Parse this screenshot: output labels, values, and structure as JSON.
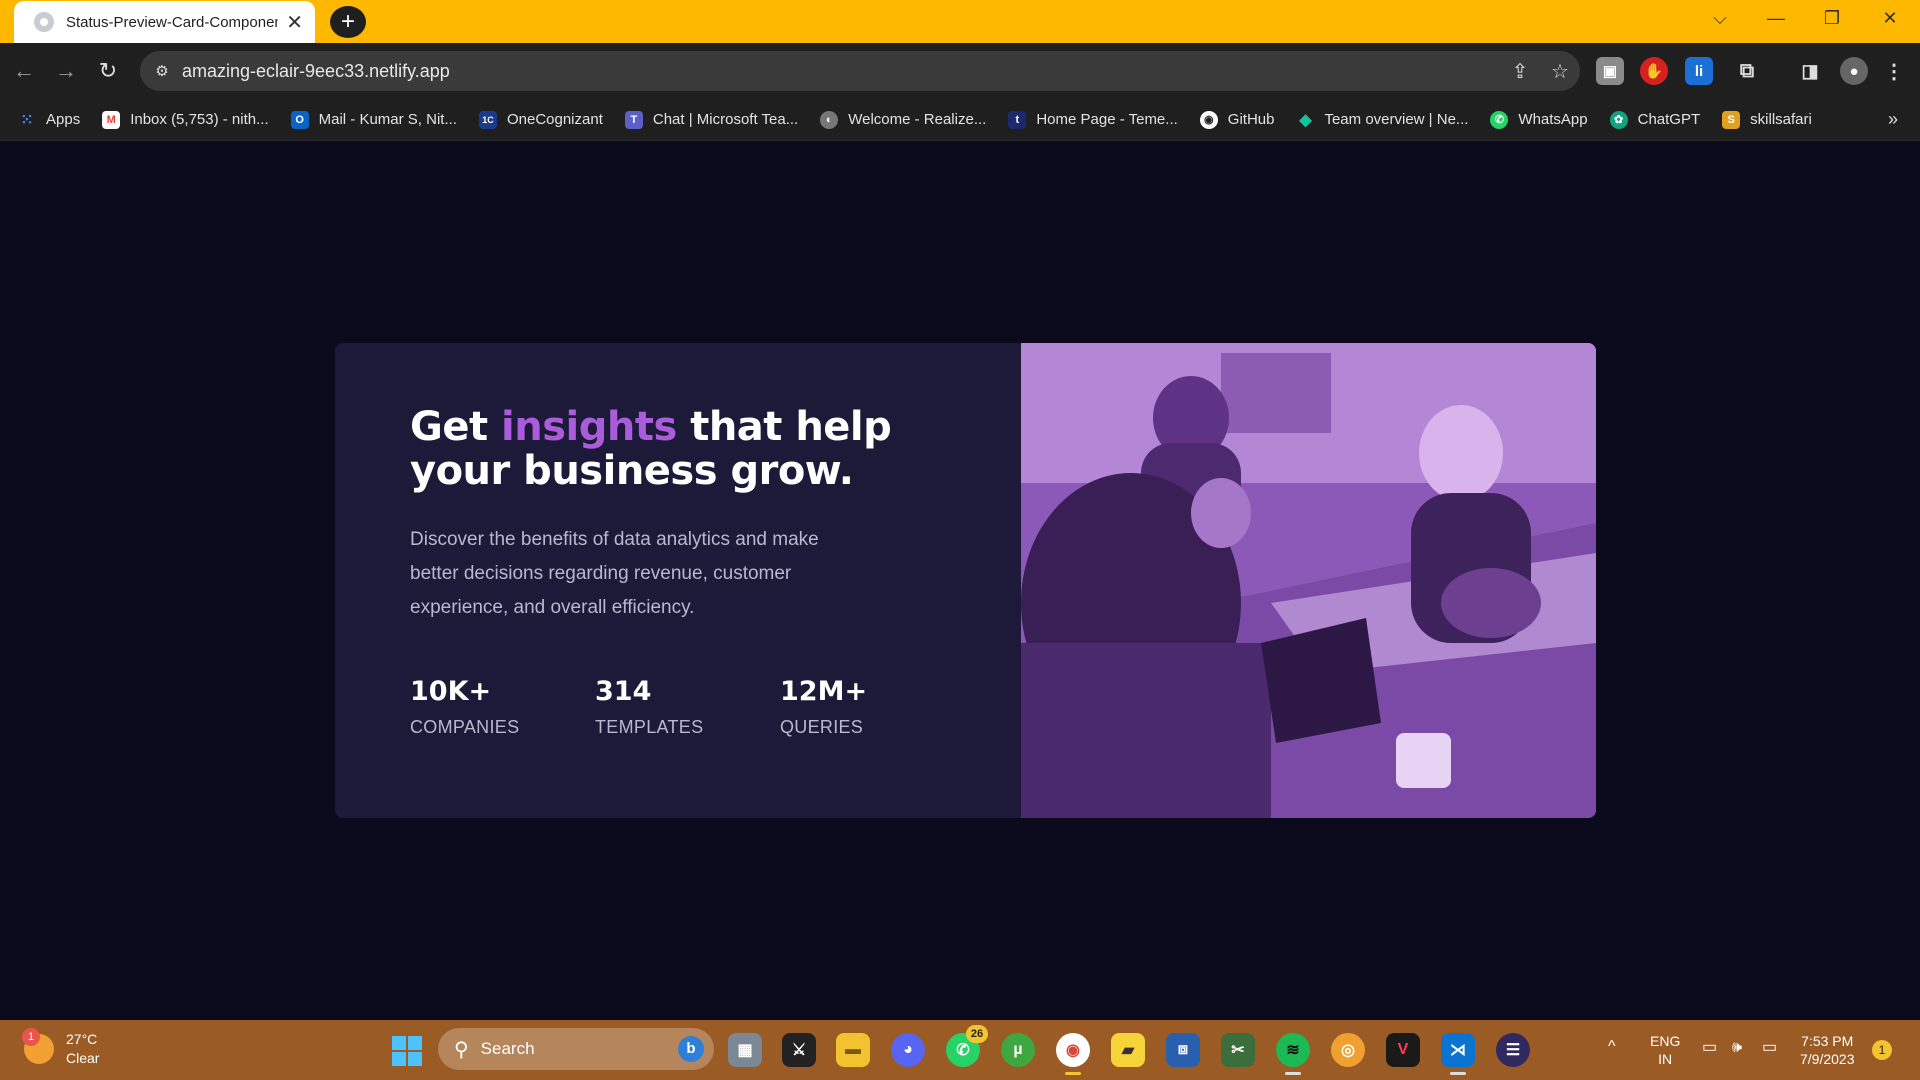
{
  "browser": {
    "tab_title": "Status-Preview-Card-Component",
    "tab_close": "✕",
    "new_tab": "+",
    "window_controls": [
      "⌵",
      "—",
      "❐",
      "✕"
    ],
    "nav": {
      "back": "←",
      "forward": "→",
      "reload": "↻"
    },
    "url": "amazing-eclair-9eec33.netlify.app",
    "site_info_icon": "tune-icon",
    "share_icon": "⇪",
    "star_icon": "☆",
    "menu_icon": "⋮"
  },
  "bookmarks": [
    {
      "label": "Apps",
      "icon": "apps-grid-icon",
      "color": "#4285f4",
      "glyph": "⁝"
    },
    {
      "label": "Inbox (5,753) - nith...",
      "icon": "gmail-icon",
      "color": "#ea4335",
      "glyph": "M"
    },
    {
      "label": "Mail - Kumar S, Nit...",
      "icon": "outlook-icon",
      "color": "#0a64c8",
      "glyph": "O"
    },
    {
      "label": "OneCognizant",
      "icon": "onecognizant-icon",
      "color": "#1a3a8a",
      "glyph": "1C"
    },
    {
      "label": "Chat | Microsoft Tea...",
      "icon": "teams-icon",
      "color": "#5b5fc7",
      "glyph": "T"
    },
    {
      "label": "Welcome - Realize...",
      "icon": "globe-icon",
      "color": "#777777",
      "glyph": "◐"
    },
    {
      "label": "Home Page - Teme...",
      "icon": "temenos-icon",
      "color": "#1b2a6b",
      "glyph": "t"
    },
    {
      "label": "GitHub",
      "icon": "github-icon",
      "color": "#333333",
      "glyph": "◉"
    },
    {
      "label": "Team overview | Ne...",
      "icon": "diamond-icon",
      "color": "#10a37f",
      "glyph": "◆"
    },
    {
      "label": "WhatsApp",
      "icon": "whatsapp-icon",
      "color": "#25d366",
      "glyph": "✆"
    },
    {
      "label": "ChatGPT",
      "icon": "chatgpt-icon",
      "color": "#10a37f",
      "glyph": "✿"
    },
    {
      "label": "skillsafari",
      "icon": "skillsafari-icon",
      "color": "#e0a020",
      "glyph": "S"
    }
  ],
  "bookmarks_more": "»",
  "card": {
    "headline_before": "Get ",
    "headline_accent": "insights",
    "headline_after": " that help your business grow.",
    "description": "Discover the benefits of data analytics and make better decisions regarding revenue, customer experience, and overall efficiency.",
    "stats": [
      {
        "value": "10K+",
        "label": "COMPANIES"
      },
      {
        "value": "314",
        "label": "TEMPLATES"
      },
      {
        "value": "12M+",
        "label": "QUERIES"
      }
    ],
    "accent_color": "#aa5cdb",
    "image_tint": "#8a55b6"
  },
  "taskbar": {
    "weather_temp": "27°C",
    "weather_text": "Clear",
    "weather_badge": "1",
    "search_placeholder": "Search",
    "whatsapp_count": "26",
    "lang_line1": "ENG",
    "lang_line2": "IN",
    "time": "7:53 PM",
    "date": "7/9/2023",
    "notification_count": "1",
    "tray_chevron": "^"
  }
}
